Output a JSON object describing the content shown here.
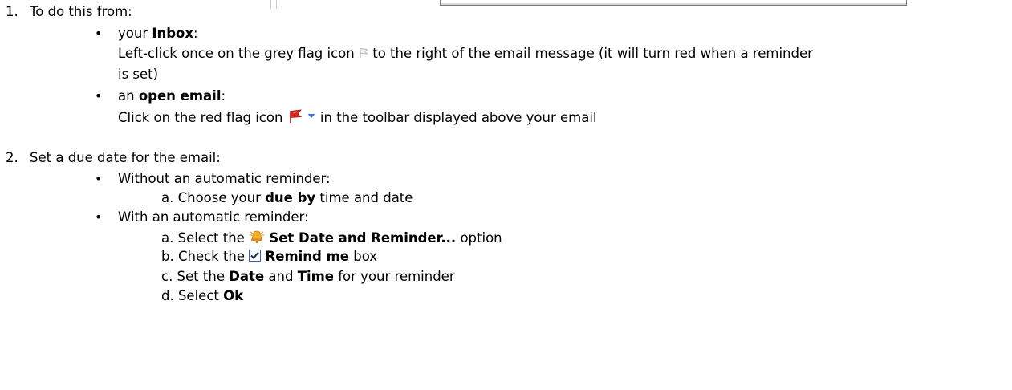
{
  "step1": {
    "number": "1.",
    "heading": "To do this from:",
    "inbox": {
      "prefix": "your ",
      "strong": "Inbox",
      "suffix": ":",
      "line1_before": "Left-click once on the grey flag icon ",
      "line1_after": " to the right of the email message (it will turn red when a reminder",
      "line2": "is set)"
    },
    "open_email": {
      "prefix": "an ",
      "strong": "open email",
      "suffix": ":",
      "line_before": "Click on the red flag icon ",
      "line_after": " in the toolbar displayed above your email"
    }
  },
  "step2": {
    "number": "2.",
    "heading": "Set a due date for the email:",
    "without": {
      "heading": "Without an automatic reminder:",
      "a": {
        "prefix": "a. Choose your ",
        "strong": "due by",
        "suffix": " time and date"
      }
    },
    "with": {
      "heading": "With an automatic reminder:",
      "a": {
        "prefix": "a. Select the ",
        "strong": "Set Date and Reminder...",
        "suffix": " option"
      },
      "b": {
        "prefix": "b. Check the ",
        "strong": "Remind me",
        "suffix": " box"
      },
      "c": {
        "prefix": "c. Set the ",
        "strong1": "Date",
        "middle": " and ",
        "strong2": "Time",
        "suffix": " for your reminder"
      },
      "d": {
        "prefix": "d. Select ",
        "strong": "Ok"
      }
    }
  },
  "bullet_char": "•",
  "icons": {
    "grey_flag": "grey-flag-icon",
    "red_flag": "red-flag-icon",
    "dropdown_arrow": "dropdown-arrow-icon",
    "reminder_bell": "reminder-bell-icon",
    "checkbox": "checked-checkbox-icon"
  },
  "colors": {
    "grey_flag": "#c8c8c8",
    "red_flag": "#d9261c",
    "dropdown_arrow": "#3f6fd0",
    "bell": "#f0a11c",
    "checkbox_border": "#3a5f9a"
  }
}
